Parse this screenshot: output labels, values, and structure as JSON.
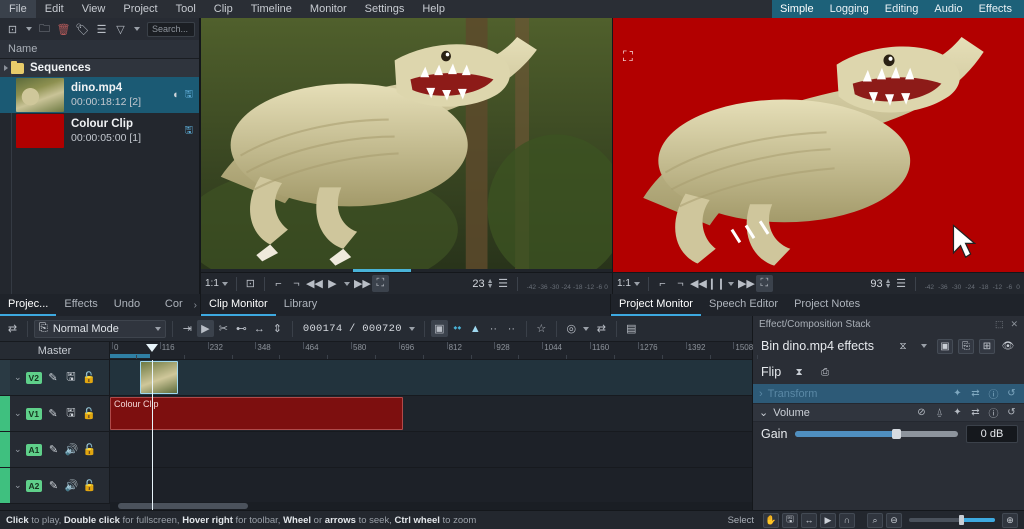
{
  "menubar": {
    "items": [
      "File",
      "Edit",
      "View",
      "Project",
      "Tool",
      "Clip",
      "Timeline",
      "Monitor",
      "Settings",
      "Help"
    ]
  },
  "layouts": {
    "items": [
      "Simple",
      "Logging",
      "Editing",
      "Audio",
      "Effects"
    ],
    "selected": "Simple",
    "accent": "#1d6179"
  },
  "project_bin": {
    "toolbar": {
      "add_clip_icon": "add-clip-icon",
      "add_clip_caret": "chevron-down-icon",
      "add_folder_icon": "folder-icon",
      "delete_icon": "delete-icon",
      "tag_icon": "tag-icon",
      "list_icon": "list-view-icon",
      "filter_icon": "filter-icon",
      "filter_caret": "chevron-down-icon"
    },
    "search": {
      "value": "",
      "placeholder": "Search..."
    },
    "column_header": "Name",
    "rows": [
      {
        "type": "folder",
        "name": "Sequences",
        "duration": "",
        "selected": false
      },
      {
        "type": "clip",
        "name": "dino.mp4",
        "duration": "00:00:18:12 [2]",
        "selected": true,
        "thumb": "dino"
      },
      {
        "type": "clip",
        "name": "Colour Clip",
        "duration": "00:00:05:00 [1]",
        "selected": false,
        "thumb": "red"
      }
    ]
  },
  "clip_monitor": {
    "aspect": "1:1",
    "frames": "23",
    "buttons": {
      "aspect_caret": "chevron-down-icon",
      "zone_icon": "set-zone-icon",
      "in_icon": "set-in-point-icon",
      "out_icon": "set-out-point-icon",
      "rewind_icon": "rewind-icon",
      "play_icon": "play-icon",
      "play_caret": "chevron-down-icon",
      "forward_icon": "fast-forward-icon",
      "fullscreen_icon": "fullscreen-icon",
      "menu_icon": "hamburger-menu-icon"
    },
    "meter_ticks": [
      "-42",
      "-36",
      "-30",
      "-24",
      "-18",
      "-12",
      "-6",
      "0"
    ],
    "scrub_position_pct": 43
  },
  "project_monitor": {
    "aspect": "1:1",
    "frames": "93",
    "overlay_icon": "move-resize-icon",
    "buttons": {
      "aspect_caret": "chevron-down-icon",
      "in_icon": "set-in-point-icon",
      "out_icon": "set-out-point-icon",
      "rewind_icon": "rewind-icon",
      "pause_icon": "pause-icon",
      "play_caret": "chevron-down-icon",
      "forward_icon": "fast-forward-icon",
      "fullscreen_icon": "fullscreen-icon",
      "menu_icon": "hamburger-menu-icon"
    },
    "meter_ticks": [
      "-42",
      "-36",
      "-30",
      "-24",
      "-18",
      "-12",
      "-6",
      "0"
    ]
  },
  "tabs": {
    "left_group": [
      "Projec...",
      "Effects",
      "Undo ...",
      "Cor"
    ],
    "left_more_icon": "chevron-right-icon",
    "left_selected": "Projec...",
    "mid_group": [
      "Clip Monitor",
      "Library"
    ],
    "mid_selected": "Clip Monitor",
    "right_group": [
      "Project Monitor",
      "Speech Editor",
      "Project Notes"
    ],
    "right_selected": "Project Monitor"
  },
  "timeline_toolbar": {
    "settings_icon": "timeline-settings-icon",
    "mode_label": "Normal Mode",
    "mode_caret": "chevron-down-icon",
    "buttons": [
      {
        "name": "insert-zone-icon",
        "active": false
      },
      {
        "name": "overwrite-zone-icon",
        "active": true
      },
      {
        "name": "razor-tool-icon",
        "active": false
      },
      {
        "name": "mix-clip-icon",
        "active": false
      },
      {
        "name": "extract-zone-icon",
        "active": false
      },
      {
        "name": "lift-zone-icon",
        "active": false
      }
    ],
    "timecode": "000174 / 000720",
    "timecode_caret": "chevron-down-icon",
    "right_buttons": [
      {
        "name": "preview-render-icon"
      },
      {
        "name": "add-marker-icon"
      },
      {
        "name": "add-guide-icon"
      },
      {
        "name": "keyframe-prev-icon"
      },
      {
        "name": "keyframe-next-icon"
      },
      {
        "name": "favorite-star-icon"
      },
      {
        "name": "record-icon"
      },
      {
        "name": "record-caret-icon"
      },
      {
        "name": "audio-mix-icon"
      },
      {
        "name": "subtitle-icon"
      }
    ]
  },
  "timeline": {
    "master_label": "Master",
    "ruler_labels": [
      "0",
      "116",
      "232",
      "348",
      "464",
      "580",
      "696",
      "812",
      "928",
      "1044",
      "1160",
      "1276",
      "1392",
      "1508"
    ],
    "playhead_frame": "174",
    "tracks": [
      {
        "id": "V2",
        "type": "video",
        "expand_icon": "chevron-down-icon",
        "icons": [
          "mute-icon",
          "lock-compose-icon",
          "lock-icon"
        ],
        "active": true
      },
      {
        "id": "V1",
        "type": "video",
        "expand_icon": "chevron-down-icon",
        "icons": [
          "mute-icon",
          "lock-compose-icon",
          "lock-icon"
        ],
        "active": false
      },
      {
        "id": "A1",
        "type": "audio",
        "expand_icon": "chevron-down-icon",
        "icons": [
          "mute-icon",
          "speaker-icon",
          "lock-icon"
        ],
        "active": false
      },
      {
        "id": "A2",
        "type": "audio",
        "expand_icon": "chevron-down-icon",
        "icons": [
          "mute-icon",
          "speaker-icon",
          "lock-icon"
        ],
        "active": false
      }
    ],
    "clips": [
      {
        "track": "V2",
        "label": "",
        "color": "#8d9050"
      },
      {
        "track": "V1",
        "label": "Colour Clip",
        "color": "#7d0f0f"
      }
    ]
  },
  "effect_stack": {
    "panel_title": "Effect/Composition Stack",
    "float_icon": "float-panel-icon",
    "close_icon": "close-icon",
    "header": "Bin dino.mp4 effects",
    "header_icons": [
      "keyframe-icon",
      "chevron-down-icon",
      "stack-icon",
      "copy-icon",
      "fit-icon",
      "preview-icon"
    ],
    "effects": [
      {
        "name": "Flip",
        "icons": [
          "keyframe-icon",
          "save-preset-icon"
        ]
      }
    ],
    "sections": [
      {
        "label": "Transform",
        "collapsed": true,
        "expand_icon": "chevron-right-icon",
        "icons": [
          "keyframe-icon",
          "automation-icon",
          "info-icon",
          "reset-icon"
        ]
      },
      {
        "label": "Volume",
        "collapsed": false,
        "expand_icon": "chevron-down-icon",
        "icons": [
          "mute-icon",
          "speaker-icon",
          "keyframe-icon",
          "automation-icon",
          "info-icon",
          "reset-icon"
        ]
      }
    ],
    "gain": {
      "label": "Gain",
      "value": "0 dB",
      "fill_pct": 62
    }
  },
  "status_bar": {
    "hint_parts": [
      {
        "text": "Click",
        "bold": true
      },
      {
        "text": " to play, ",
        "bold": false
      },
      {
        "text": "Double click",
        "bold": true
      },
      {
        "text": " for fullscreen, ",
        "bold": false
      },
      {
        "text": "Hover right",
        "bold": true
      },
      {
        "text": " for toolbar, ",
        "bold": false
      },
      {
        "text": "Wheel",
        "bold": true
      },
      {
        "text": " or ",
        "bold": false
      },
      {
        "text": "arrows",
        "bold": true
      },
      {
        "text": " to seek, ",
        "bold": false
      },
      {
        "text": "Ctrl wheel",
        "bold": true
      },
      {
        "text": " to zoom",
        "bold": false
      }
    ],
    "hint_text": "Click to play, Double click for fullscreen, Hover right for toolbar, Wheel or arrows to seek, Ctrl wheel to zoom",
    "tool_label": "Select",
    "tools": [
      "select-tool-icon",
      "razor-tool-icon",
      "spacer-tool-icon",
      "ripple-tool-icon",
      "snap-icon"
    ],
    "zoom_out_icon": "zoom-out-icon",
    "zoom_in_icon": "zoom-in-icon",
    "zoom_fit_icon": "zoom-fit-icon"
  }
}
